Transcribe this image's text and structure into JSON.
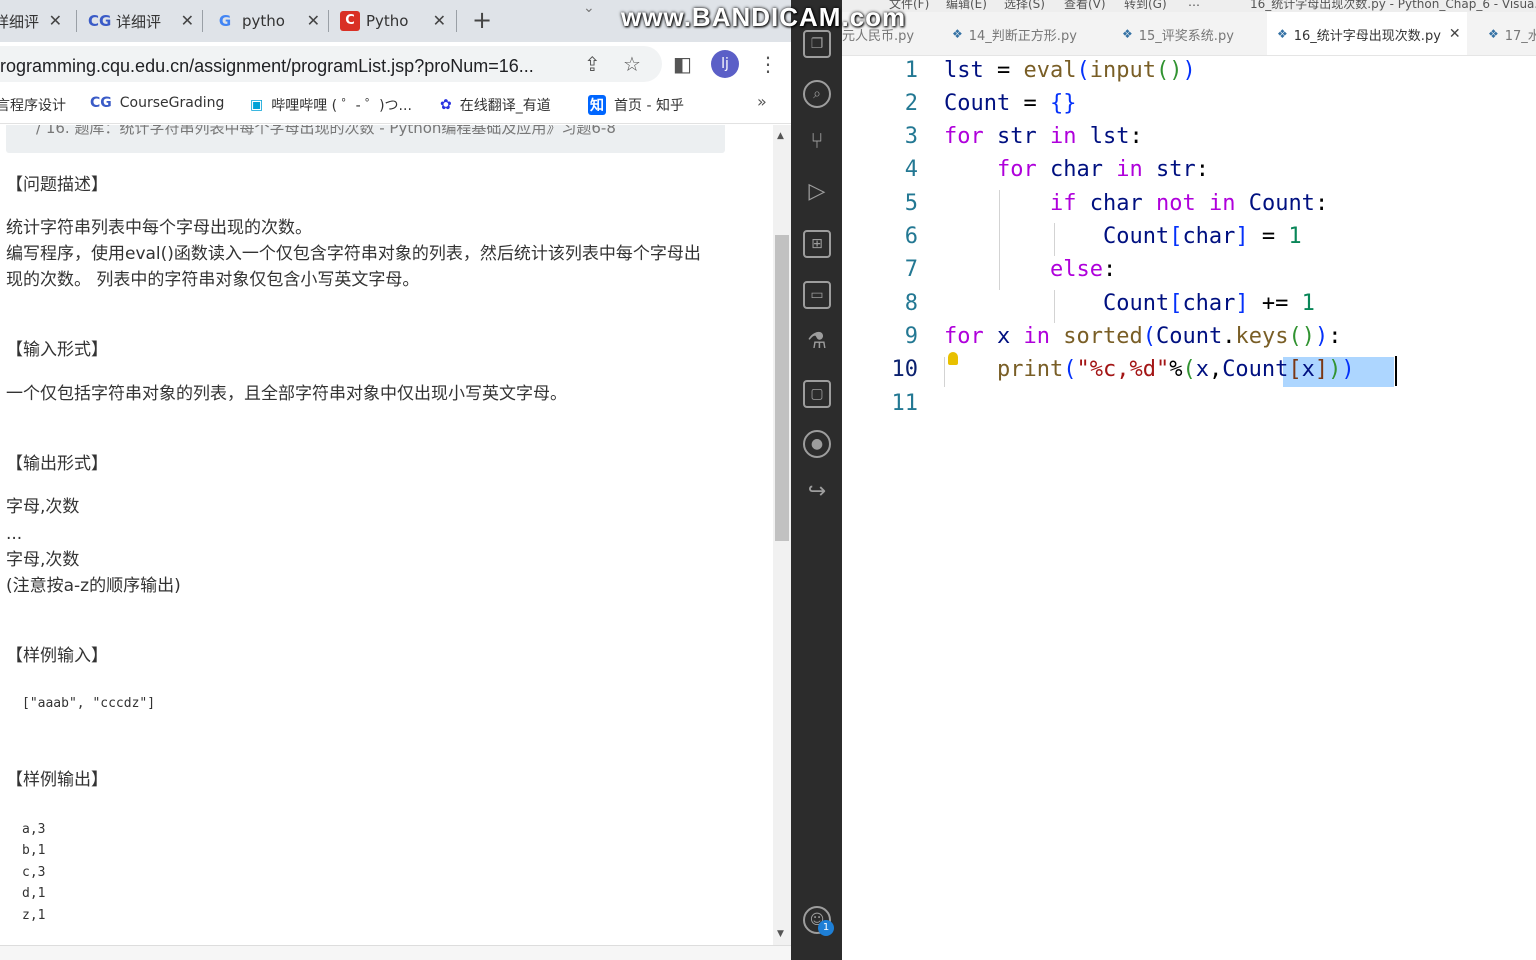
{
  "browser": {
    "tabs": [
      {
        "icon": "",
        "label": "详细评",
        "close": "✕"
      },
      {
        "icon": "CG",
        "label": "详细评",
        "close": "✕"
      },
      {
        "icon": "G",
        "label": "pytho",
        "close": "✕"
      },
      {
        "icon": "C",
        "label": "Pytho",
        "close": "✕"
      }
    ],
    "new_tab": "+",
    "url": "rogramming.cqu.edu.cn/assignment/programList.jsp?proNum=16...",
    "avatar": "lj",
    "bookmarks": [
      {
        "icon": "",
        "label": "言程序设计"
      },
      {
        "icon": "CG",
        "label": "CourseGrading"
      },
      {
        "icon": "▣",
        "label": "哔哩哔哩 ( ゜- ゜)つ..."
      },
      {
        "icon": "✿",
        "label": "在线翻译_有道"
      },
      {
        "icon": "知",
        "label": "首页 - 知乎"
      }
    ],
    "bookmarks_more": "»"
  },
  "problem": {
    "breadcrumb": "/ 16. 题库：统计字符串列表中每个字母出现的次数 - Python编程基础及应用》习题6-8",
    "desc_heading": "【问题描述】",
    "desc_lines": [
      "统计字符串列表中每个字母出现的次数。",
      "编写程序，使用eval()函数读入一个仅包含字符串对象的列表，然后统计该列表中每个字母出",
      "现的次数。 列表中的字符串对象仅包含小写英文字母。"
    ],
    "input_heading": "【输入形式】",
    "input_text": "一个仅包括字符串对象的列表，且全部字符串对象中仅出现小写英文字母。",
    "output_heading": "【输出形式】",
    "output_lines": [
      "字母,次数",
      "...",
      "字母,次数",
      "(注意按a-z的顺序输出)"
    ],
    "sample_in_heading": "【样例输入】",
    "sample_in": "[\"aaab\", \"cccdz\"]",
    "sample_out_heading": "【样例输出】",
    "sample_out": [
      "a,3",
      "b,1",
      "c,3",
      "d,1",
      "z,1"
    ]
  },
  "vscode": {
    "menu": [
      "文件(F)",
      "编辑(E)",
      "选择(S)",
      "查看(V)",
      "转到(G)",
      "…"
    ],
    "window_title": "16_统计字母出现次数.py - Python_Chap_6 - Visua...",
    "tabs": [
      {
        "label": "元人民币.py",
        "active": false
      },
      {
        "label": "14_判断正方形.py",
        "active": false
      },
      {
        "label": "15_评奖系统.py",
        "active": false
      },
      {
        "label": "16_统计字母出现次数.py",
        "active": true
      },
      {
        "label": "17_水",
        "active": false
      }
    ],
    "line_numbers": [
      "1",
      "2",
      "3",
      "4",
      "5",
      "6",
      "7",
      "8",
      "9",
      "10",
      "11"
    ],
    "account_badge": "1"
  },
  "watermark": "www.BANDICAM.com"
}
